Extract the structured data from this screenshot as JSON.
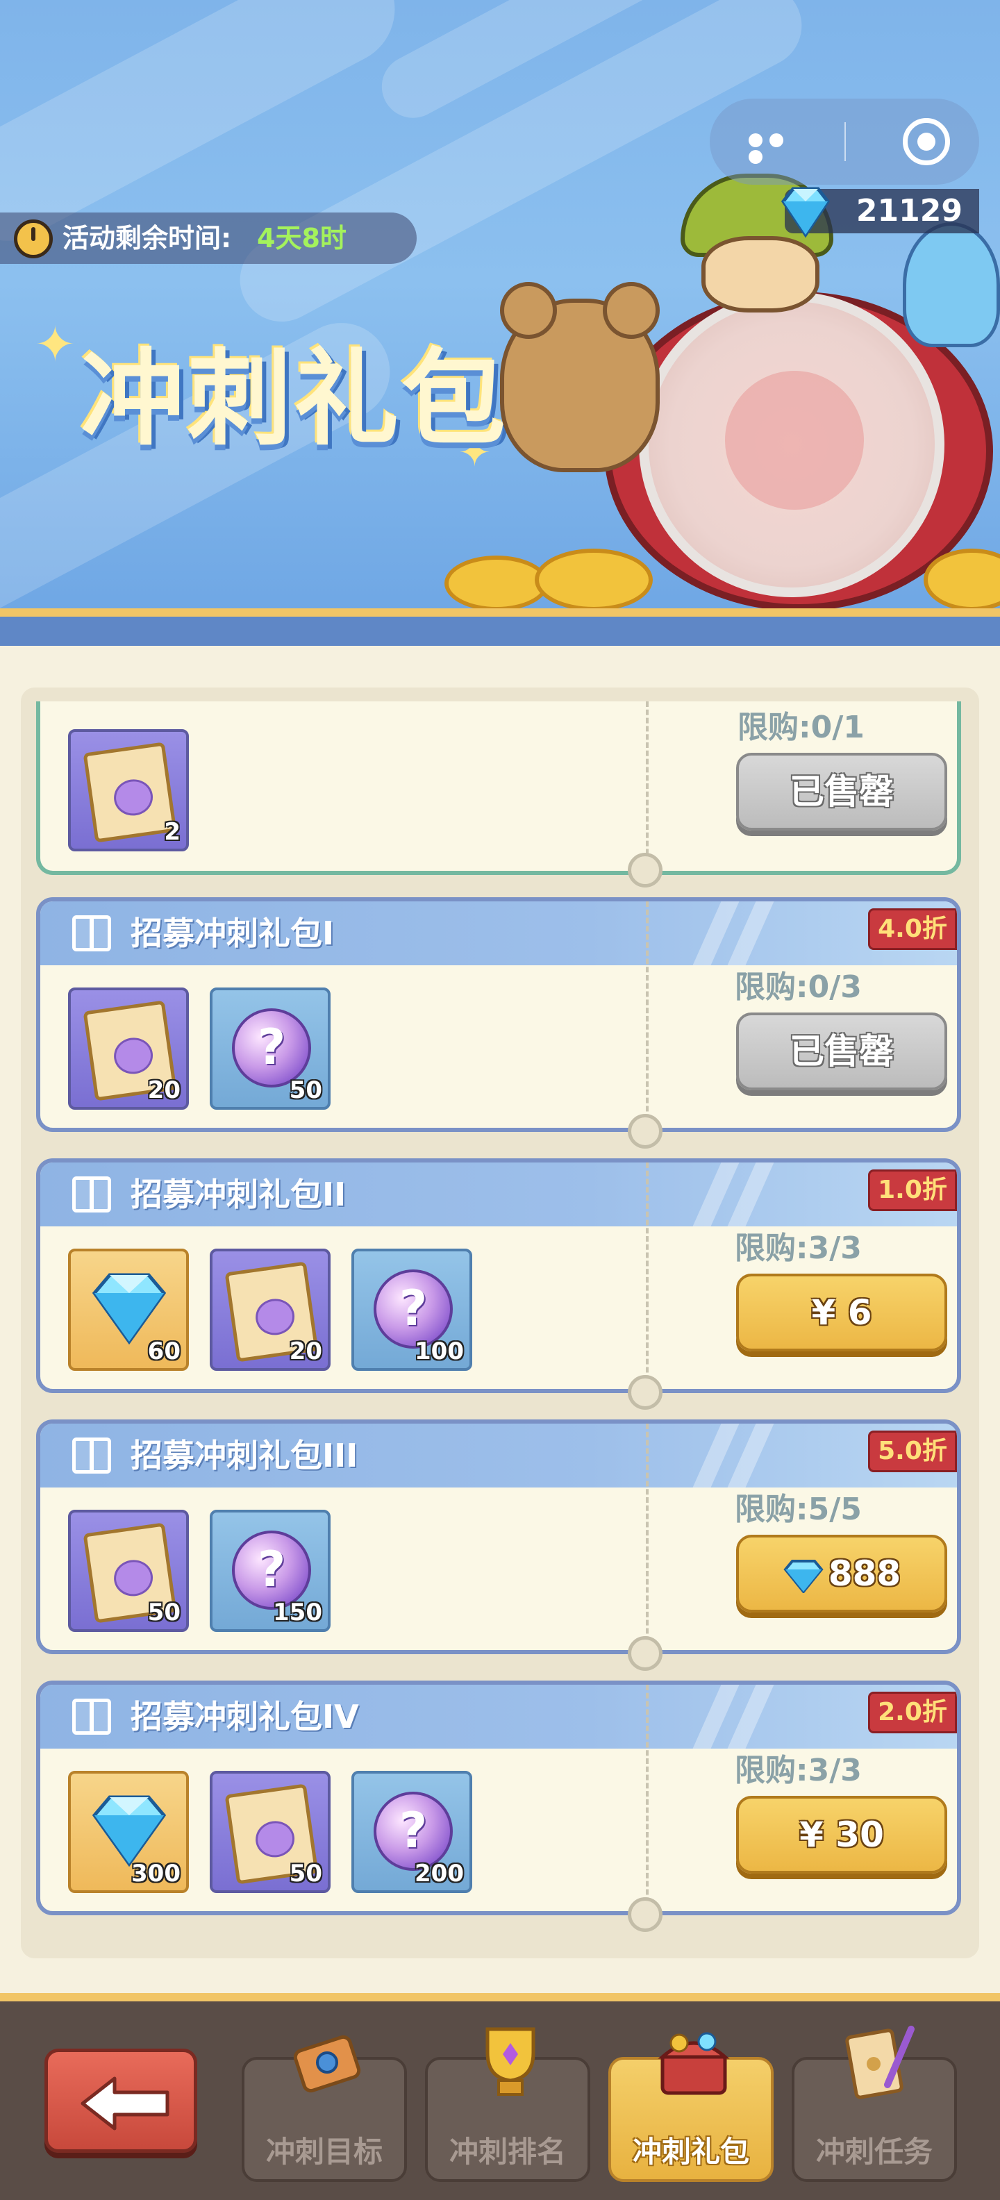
{
  "header": {
    "gem_count": "21129",
    "timer_label": "活动剩余时间:",
    "timer_value": "4天8时",
    "title": "冲刺礼包"
  },
  "first_item": {
    "qty": "2",
    "limit": "限购:0/1",
    "button": "已售罄"
  },
  "packs": [
    {
      "name": "招募冲刺礼包I",
      "discount": "4.0折",
      "limit": "限购:0/3",
      "button": "已售罄",
      "items": [
        {
          "type": "recruit-scroll",
          "qty": "20"
        },
        {
          "type": "mystery-orb",
          "qty": "50"
        }
      ]
    },
    {
      "name": "招募冲刺礼包II",
      "discount": "1.0折",
      "limit": "限购:3/3",
      "button": "¥ 6",
      "items": [
        {
          "type": "diamond",
          "qty": "60"
        },
        {
          "type": "recruit-scroll",
          "qty": "20"
        },
        {
          "type": "mystery-orb",
          "qty": "100"
        }
      ]
    },
    {
      "name": "招募冲刺礼包III",
      "discount": "5.0折",
      "limit": "限购:5/5",
      "button": "888",
      "items": [
        {
          "type": "recruit-scroll",
          "qty": "50"
        },
        {
          "type": "mystery-orb",
          "qty": "150"
        }
      ]
    },
    {
      "name": "招募冲刺礼包IV",
      "discount": "2.0折",
      "limit": "限购:3/3",
      "button": "¥ 30",
      "items": [
        {
          "type": "diamond",
          "qty": "300"
        },
        {
          "type": "recruit-scroll",
          "qty": "50"
        },
        {
          "type": "mystery-orb",
          "qty": "200"
        }
      ]
    }
  ],
  "nav": {
    "tabs": [
      {
        "label": "冲刺目标",
        "icon": "scroll-banner-icon"
      },
      {
        "label": "冲刺排名",
        "icon": "trophy-icon"
      },
      {
        "label": "冲刺礼包",
        "icon": "treasure-chest-icon",
        "active": true
      },
      {
        "label": "冲刺任务",
        "icon": "quest-letter-icon"
      }
    ]
  },
  "colors": {
    "sky": "#8cc0ef",
    "panel": "#f6f1df",
    "discount": "#c93a3f",
    "buy_button": "#ecb745",
    "sold_button": "#bcbcbc",
    "nav_bg": "#5a4d47"
  }
}
